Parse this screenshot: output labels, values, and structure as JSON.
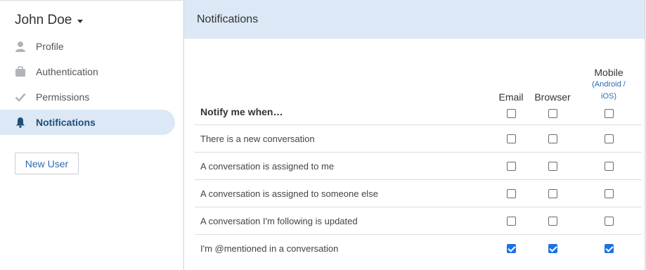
{
  "user": {
    "name": "John Doe"
  },
  "sidebar": {
    "items": [
      {
        "label": "Profile",
        "icon": "person-icon",
        "active": false
      },
      {
        "label": "Authentication",
        "icon": "briefcase-icon",
        "active": false
      },
      {
        "label": "Permissions",
        "icon": "checkmark-icon",
        "active": false
      },
      {
        "label": "Notifications",
        "icon": "bell-icon",
        "active": true
      }
    ],
    "new_user_label": "New User"
  },
  "main": {
    "title": "Notifications",
    "table": {
      "header_label": "Notify me when…",
      "columns": {
        "email": "Email",
        "browser": "Browser",
        "mobile": "Mobile",
        "mobile_sub_1": "(Android /",
        "mobile_sub_2": "iOS)"
      },
      "header_checks": {
        "email": false,
        "browser": false,
        "mobile": false
      },
      "rows": [
        {
          "label": "There is a new conversation",
          "email": false,
          "browser": false,
          "mobile": false
        },
        {
          "label": "A conversation is assigned to me",
          "email": false,
          "browser": false,
          "mobile": false
        },
        {
          "label": "A conversation is assigned to someone else",
          "email": false,
          "browser": false,
          "mobile": false
        },
        {
          "label": "A conversation I'm following is updated",
          "email": false,
          "browser": false,
          "mobile": false
        },
        {
          "label": "I'm @mentioned in a conversation",
          "email": true,
          "browser": true,
          "mobile": true
        }
      ]
    }
  },
  "colors": {
    "accent": "#1a73e8",
    "active_bg": "#dce8f5",
    "link": "#2b6cb0"
  }
}
